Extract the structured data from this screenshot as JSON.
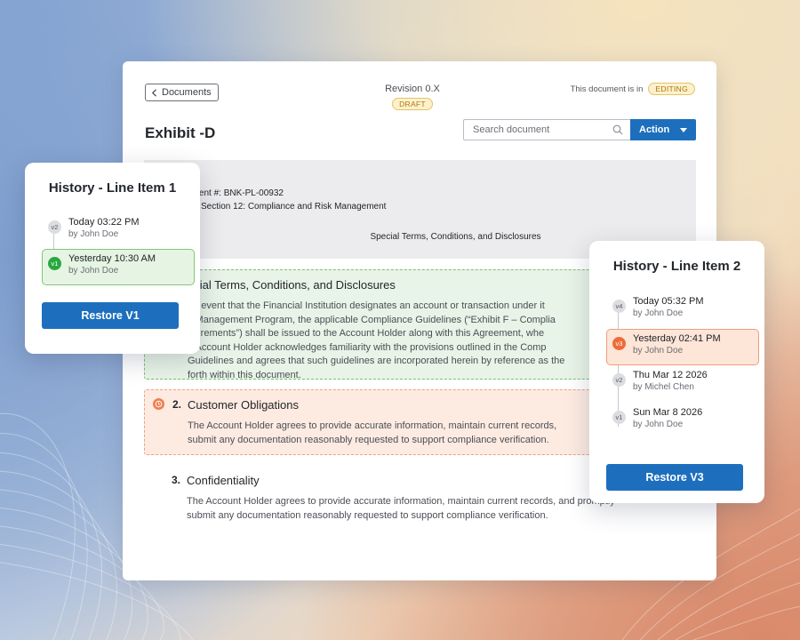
{
  "document": {
    "back_label": "Documents",
    "revision_label": "Revision 0.X",
    "draft_badge": "DRAFT",
    "status_text": "This document is in",
    "status_badge": "EDITING",
    "title": "Exhibit -D",
    "search_placeholder": "Search document",
    "action_label": "Action",
    "doc_number": "ument #: BNK-PL-00932",
    "section": "Section 12: Compliance and Risk Management",
    "special_heading": "Special Terms, Conditions, and Disclosures"
  },
  "clauses": [
    {
      "number": "",
      "heading": "ecial Terms, Conditions, and Disclosures",
      "body_lines": [
        "he event that the Financial Institution designates an account or transaction under it",
        "k Management Program, the applicable Compliance Guidelines (“Exhibit F – Complia",
        "quirements”) shall be issued to the Account Holder along with this Agreement, whe",
        "e Account Holder acknowledges familiarity with the provisions outlined in the Comp",
        "Guidelines and agrees that such guidelines are incorporated herein by reference as the",
        "forth within this document."
      ],
      "state": "accepted"
    },
    {
      "number": "2.",
      "heading": "Customer Obligations",
      "body_lines": [
        "The Account Holder agrees to provide accurate information, maintain current records,",
        "submit any documentation reasonably requested to support compliance verification."
      ],
      "state": "changed"
    },
    {
      "number": "3.",
      "heading": "Confidentiality",
      "body_lines": [
        "The Account Holder agrees to provide accurate information, maintain current records, and promptly",
        "submit any documentation reasonably requested to support compliance verification."
      ],
      "state": "unchanged"
    }
  ],
  "history_1": {
    "title": "History - Line Item 1",
    "versions": [
      {
        "tag": "v2",
        "date": "Today 03:22 PM",
        "author": "by John Doe"
      },
      {
        "tag": "v1",
        "date": "Yesterday 10:30 AM",
        "author": "by John Doe"
      }
    ],
    "restore_label": "Restore V1"
  },
  "history_2": {
    "title": "History - Line Item 2",
    "versions": [
      {
        "tag": "v4",
        "date": "Today 05:32 PM",
        "author": "by John Doe"
      },
      {
        "tag": "v3",
        "date": "Yesterday 02:41 PM",
        "author": "by John Doe"
      },
      {
        "tag": "v2",
        "date": "Thu Mar 12 2026",
        "author": "by Michel Chen"
      },
      {
        "tag": "v1",
        "date": "Sun Mar 8 2026",
        "author": "by John Doe"
      }
    ],
    "restore_label": "Restore V3"
  },
  "colors": {
    "accent": "#1d6fbd",
    "accepted": "#28a83f",
    "changed": "#ee6b3a"
  }
}
